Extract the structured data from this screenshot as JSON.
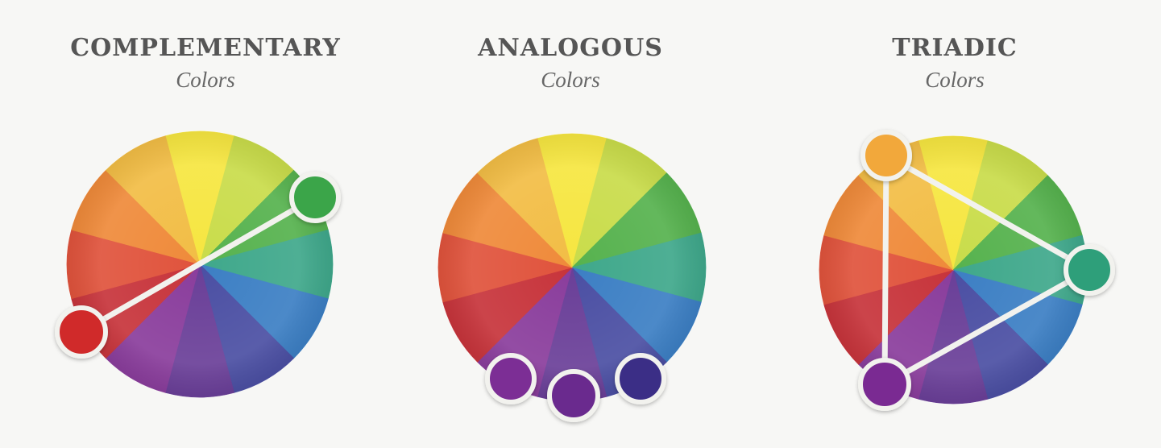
{
  "panels": [
    {
      "title": "COMPLEMENTARY",
      "subtitle": "Colors",
      "scheme": "complementary",
      "marker_colors": [
        "#3aa54a",
        "#d02a2a"
      ]
    },
    {
      "title": "ANALOGOUS",
      "subtitle": "Colors",
      "scheme": "analogous",
      "marker_colors": [
        "#7b2f95",
        "#6a2a8e",
        "#3a2f86"
      ]
    },
    {
      "title": "TRIADIC",
      "subtitle": "Colors",
      "scheme": "triadic",
      "marker_colors": [
        "#f2a83a",
        "#2f9f7a",
        "#7a2b92"
      ]
    }
  ],
  "wheel_colors": [
    "#f6e640",
    "#c9dc4a",
    "#56b24e",
    "#3fa88b",
    "#3c7fc4",
    "#4b4fa3",
    "#6a3f98",
    "#8a3d9c",
    "#c7343b",
    "#e0533c",
    "#ef8a3a",
    "#f2bd45"
  ],
  "background_color": "#f7f7f5",
  "connector_color": "#f2f2ee"
}
